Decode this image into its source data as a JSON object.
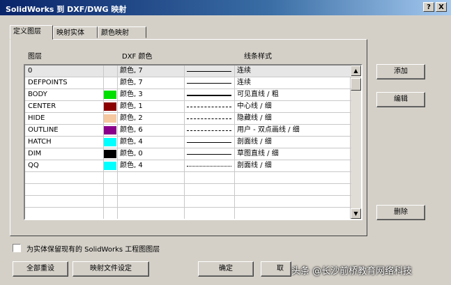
{
  "window": {
    "title": "SolidWorks 到 DXF/DWG 映射",
    "help_button": "?",
    "close_button": "X"
  },
  "tabs": [
    "定义图层",
    "映射实体",
    "颜色映射"
  ],
  "columns": {
    "layer": "图层",
    "dxf_color": "DXF 颜色",
    "line_style": "线条样式"
  },
  "rows": [
    {
      "layer": "0",
      "swatch": "",
      "color": "颜色, 7",
      "line": "solid",
      "style": "连续"
    },
    {
      "layer": "DEFPOINTS",
      "swatch": "",
      "color": "颜色, 7",
      "line": "solid",
      "style": "连续"
    },
    {
      "layer": "BODY",
      "swatch": "#00e000",
      "color": "颜色, 3",
      "line": "solid-thick",
      "style": "可见直线 / 粗"
    },
    {
      "layer": "CENTER",
      "swatch": "#8b0000",
      "color": "颜色, 1",
      "line": "dashdot",
      "style": "中心线 / 细"
    },
    {
      "layer": "HIDE",
      "swatch": "#f5c8a0",
      "color": "颜色, 2",
      "line": "dashed",
      "style": "隐藏线 / 细"
    },
    {
      "layer": "OUTLINE",
      "swatch": "#8b008b",
      "color": "颜色, 6",
      "line": "dashdotdot",
      "style": "用户 - 双点画线 / 细"
    },
    {
      "layer": "HATCH",
      "swatch": "#00ffff",
      "color": "颜色, 4",
      "line": "solid",
      "style": "剖面线 / 细"
    },
    {
      "layer": "DIM",
      "swatch": "#000000",
      "color": "颜色, 0",
      "line": "solid",
      "style": "草图直线 / 细"
    },
    {
      "layer": "QQ",
      "swatch": "#00ffff",
      "color": "颜色, 4",
      "line": "dotted",
      "style": "剖面线 / 细"
    }
  ],
  "side_buttons": {
    "add": "添加",
    "edit": "编辑",
    "delete": "删除"
  },
  "checkbox": {
    "label": "为实体保留现有的 SolidWorks 工程图图层",
    "checked": false
  },
  "bottom_buttons": {
    "reset": "全部重设",
    "mapping_file": "映射文件设定",
    "ok": "确定",
    "cancel": "取"
  },
  "watermark": "头条 @长沙前桥教育网络科技"
}
